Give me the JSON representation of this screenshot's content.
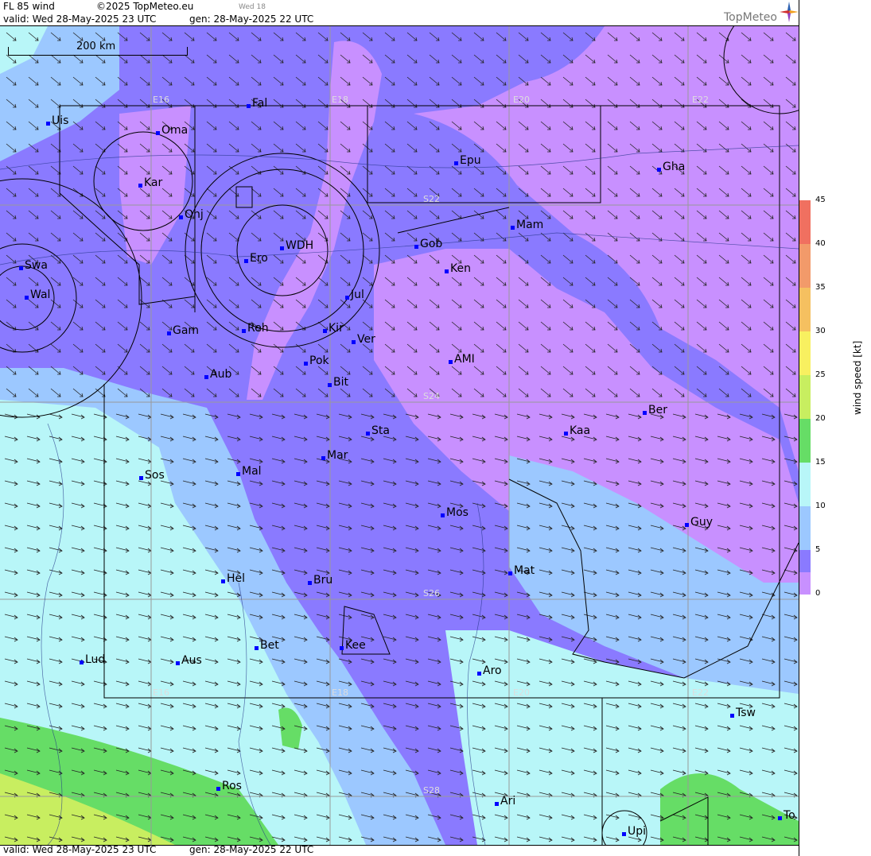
{
  "header": {
    "product": "FL 85 wind",
    "copyright": "©2025 TopMeteo.eu",
    "day_tag": "Wed 18",
    "valid": "valid:  Wed  28-May-2025  23 UTC",
    "gen": "gen: 28-May-2025 22 UTC",
    "logo": "TopMeteo"
  },
  "footer": {
    "valid": "valid:  Wed  28-May-2025  23 UTC",
    "gen": "gen: 28-May-2025 22 UTC"
  },
  "scale_bar": "200 km",
  "legend": {
    "title": "wind  speed  [kt]",
    "ticks": [
      "45",
      "40",
      "35",
      "30",
      "25",
      "20",
      "15",
      "10",
      "5",
      "0"
    ],
    "colors": [
      "#f07060",
      "#f29a6a",
      "#f5c060",
      "#f8f060",
      "#c8ee60",
      "#66dd66",
      "#b8f6f8",
      "#9cc8ff",
      "#8a7aff",
      "#c890ff"
    ]
  },
  "grid_labels": [
    {
      "id": "E16-top",
      "text": "E16"
    },
    {
      "id": "E18-top",
      "text": "E18"
    },
    {
      "id": "E20-top",
      "text": "E20"
    },
    {
      "id": "E22-top",
      "text": "E22"
    },
    {
      "id": "S22",
      "text": "S22"
    },
    {
      "id": "S24",
      "text": "S24"
    },
    {
      "id": "S26",
      "text": "S26"
    },
    {
      "id": "S28",
      "text": "S28"
    },
    {
      "id": "E16-bot",
      "text": "E16"
    },
    {
      "id": "E18-bot",
      "text": "E18"
    },
    {
      "id": "E20-bot",
      "text": "E20"
    },
    {
      "id": "E22-bot",
      "text": "E22"
    }
  ],
  "towns": [
    "Uis",
    "Oma",
    "Fal",
    "Kar",
    "Onj",
    "Epu",
    "Gha",
    "Mam",
    "Gob",
    "Ken",
    "Swa",
    "WDH",
    "Ero",
    "Wal",
    "Jul",
    "Gam",
    "Reh",
    "Kir",
    "Ver",
    "AMI",
    "Pok",
    "Aub",
    "Bit",
    "Ber",
    "Sta",
    "Kaa",
    "Mar",
    "Sos",
    "Mal",
    "Mos",
    "Guy",
    "Mat",
    "Hel",
    "Bru",
    "Bet",
    "Kee",
    "Lud",
    "Aus",
    "Aro",
    "Tsw",
    "Ros",
    "Ari",
    "To",
    "Upi"
  ]
}
